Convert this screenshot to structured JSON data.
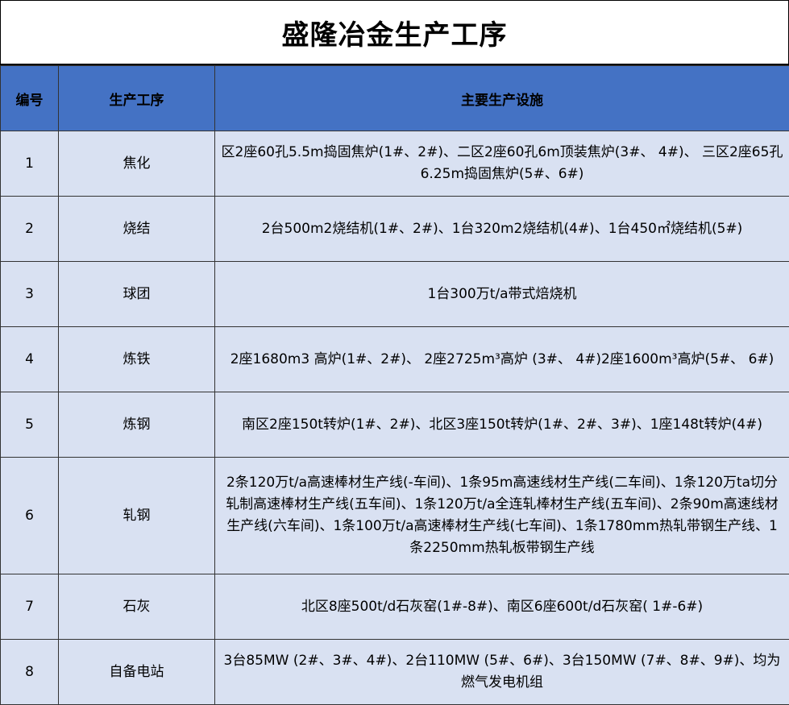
{
  "title": "盛隆冶金生产工序",
  "colors": {
    "header_bg": "#4472C4",
    "row_bg": "#D9E1F2",
    "border": "#333333"
  },
  "headers": {
    "no": "编号",
    "process": "生产工序",
    "facilities": "主要生产设施"
  },
  "rows": [
    {
      "no": "1",
      "process": "焦化",
      "facilities": "区2座60孔5.5m捣固焦炉(1#、2#)、二区2座60孔6m顶装焦炉(3#、 4#)、 三区2座65孔6.25m捣固焦炉(5#、6#)"
    },
    {
      "no": "2",
      "process": "烧结",
      "facilities": "2台500m2烧结机(1#、2#)、1台320m2烧结机(4#)、1台450㎡烧结机(5#)"
    },
    {
      "no": "3",
      "process": "球团",
      "facilities": "1台300万t/a带式焙烧机"
    },
    {
      "no": "4",
      "process": "炼铁",
      "facilities": "2座1680m3 高炉(1#、2#)、 2座2725m³高炉 (3#、 4#)2座1600m³高炉(5#、 6#)"
    },
    {
      "no": "5",
      "process": "炼钢",
      "facilities": "南区2座150t转炉(1#、2#)、北区3座150t转炉(1#、2#、3#)、1座148t转炉(4#)"
    },
    {
      "no": "6",
      "process": "轧钢",
      "facilities": "2条120万t/a高速棒材生产线(-车间)、1条95m高速线材生产线(二车间)、1条120万ta切分轧制高速棒材生产线(五车间)、1条120万t/a全连轧棒材生产线(五车间)、2条90m高速线材生产线(六车间)、1条100万t/a高速棒材生产线(七车间)、1条1780mm热轧带钢生产线、1条2250mm热轧板带钢生产线"
    },
    {
      "no": "7",
      "process": "石灰",
      "facilities": "北区8座500t/d石灰窑(1#-8#)、南区6座600t/d石灰窑( 1#-6#)"
    },
    {
      "no": "8",
      "process": "自备电站",
      "facilities": "3台85MW (2#、3#、4#)、2台110MW (5#、6#)、3台150MW (7#、8#、9#)、均为燃气发电机组"
    }
  ]
}
